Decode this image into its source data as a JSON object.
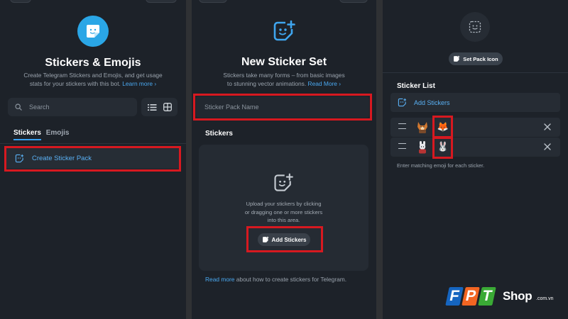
{
  "colors": {
    "accent": "#2aa6e6",
    "link": "#4aa8f0",
    "highlight": "#d71920",
    "panel_bg": "#1d2229",
    "brand_blue": "#1565c0",
    "brand_orange": "#f26522",
    "brand_green": "#3aaa35"
  },
  "panel1": {
    "title": "Stickers & Emojis",
    "subtitle_line1": "Create Telegram Stickers and Emojis, and get usage",
    "subtitle_line2": "stats for your stickers with this bot.",
    "learn_more": "Learn more ›",
    "search_placeholder": "Search",
    "tabs": [
      "Stickers",
      "Emojis"
    ],
    "create_pack": "Create Sticker Pack"
  },
  "panel2": {
    "title": "New Sticker Set",
    "subtitle_line1": "Stickers take many forms – from basic images",
    "subtitle_line2": "to stunning vector animations.",
    "read_more_link": "Read More ›",
    "name_placeholder": "Sticker Pack Name",
    "section_label": "Stickers",
    "upload_line1": "Upload your stickers by clicking",
    "upload_line2": "or dragging one or more stickers",
    "upload_line3": "into this area.",
    "add_button": "Add Stickers",
    "footer_link": "Read more",
    "footer_text": " about how to create stickers for Telegram."
  },
  "panel3": {
    "set_pack_icon": "Set Pack Icon",
    "list_title": "Sticker List",
    "add_stickers": "Add Stickers",
    "stickers": [
      {
        "emoji": "🦊"
      },
      {
        "emoji": "🐰"
      }
    ],
    "hint": "Enter matching emoji for each sticker."
  },
  "brand": {
    "letters": [
      "F",
      "P",
      "T"
    ],
    "shop": "Shop",
    "domain": ".com.vn"
  }
}
